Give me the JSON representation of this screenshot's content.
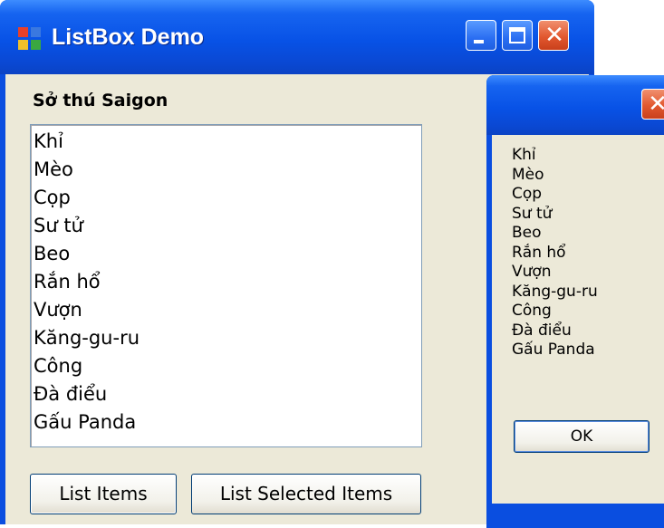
{
  "main_window": {
    "title": "ListBox Demo",
    "group_label": "Sở thú Saigon",
    "list_items": [
      "Khỉ",
      "Mèo",
      "Cọp",
      "Sư tử",
      "Beo",
      "Rắn hổ",
      "Vượn",
      "Kăng-gu-ru",
      "Công",
      "Đà điểu",
      "Gấu Panda"
    ],
    "buttons": {
      "list_items": "List Items",
      "list_selected_items": "List Selected Items"
    },
    "caption_buttons": {
      "close_glyph": "✕"
    }
  },
  "message_box": {
    "close_glyph": "✕",
    "lines": [
      "Khỉ",
      "Mèo",
      "Cọp",
      "Sư tử",
      "Beo",
      "Rắn hổ",
      "Vượn",
      "Kăng-gu-ru",
      "Công",
      "Đà điểu",
      "Gấu Panda"
    ],
    "ok_label": "OK"
  },
  "colors": {
    "titlebar_blue": "#0852e6",
    "face": "#ece9d8",
    "close_red": "#e2582f",
    "border_blue": "#7f9db9"
  },
  "icons": {
    "app_icon": "windows-form-icon",
    "minimize": "minimize-icon",
    "maximize": "maximize-icon",
    "close": "close-icon"
  }
}
